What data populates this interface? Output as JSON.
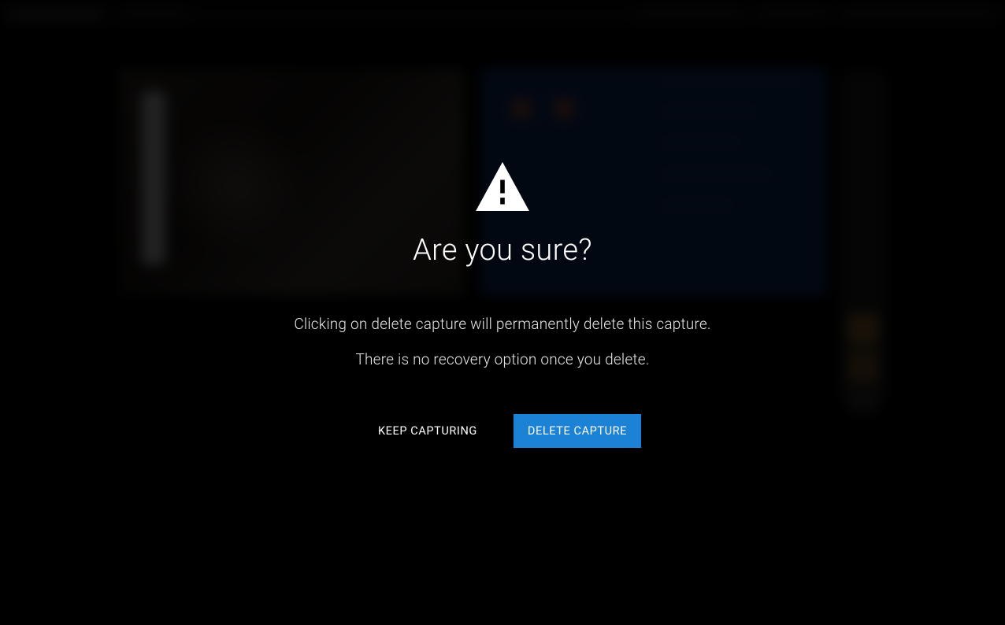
{
  "modal": {
    "title": "Are you sure?",
    "line1": "Clicking on delete capture will permanently delete this capture.",
    "line2": "There is no recovery option once you delete.",
    "keep_label": "KEEP CAPTURING",
    "delete_label": "DELETE CAPTURE"
  },
  "colors": {
    "primary_button": "#1c82d6",
    "background": "#000000",
    "text": "#ffffff"
  }
}
